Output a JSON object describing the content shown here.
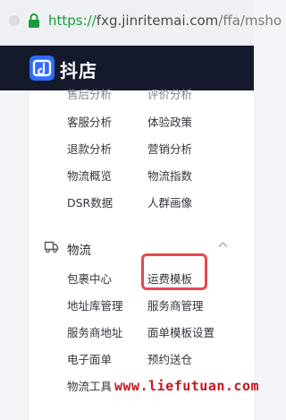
{
  "browser": {
    "url_scheme": "https://",
    "url_host": "fxg.jinritemai.com",
    "url_path": "/ffa/msho"
  },
  "header": {
    "brand": "抖店",
    "logo_icon": "doudian-logo-icon"
  },
  "menu": {
    "data_items_partial": [
      "售后分析",
      "评价分析"
    ],
    "data_items": [
      [
        "客服分析",
        "体验政策"
      ],
      [
        "退款分析",
        "营销分析"
      ],
      [
        "物流概览",
        "物流指数"
      ],
      [
        "DSR数据",
        "人群画像"
      ]
    ],
    "logistics": {
      "title": "物流",
      "icon": "truck-icon",
      "items": [
        [
          "包裹中心",
          "运费模板"
        ],
        [
          "地址库管理",
          "服务商管理"
        ],
        [
          "服务商地址",
          "面单模板设置"
        ],
        [
          "电子面单",
          "预约送仓"
        ],
        [
          "物流工具"
        ]
      ]
    }
  },
  "highlight": {
    "color": "#e5484d",
    "target": "运费模板"
  },
  "watermark": "www.liefutuan.com"
}
